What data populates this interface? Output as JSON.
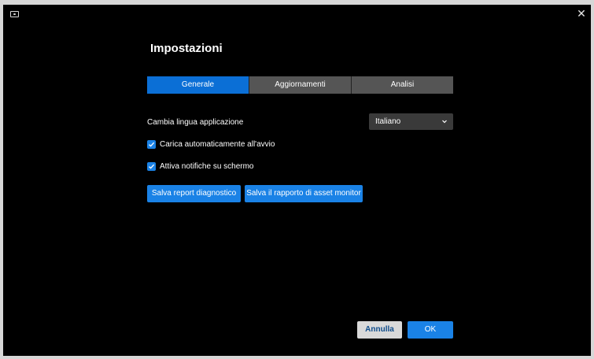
{
  "window": {
    "title": "Impostazioni"
  },
  "tabs": [
    {
      "label": "Generale",
      "active": true
    },
    {
      "label": "Aggiornamenti",
      "active": false
    },
    {
      "label": "Analisi",
      "active": false
    }
  ],
  "language": {
    "label": "Cambia lingua applicazione",
    "selected": "Italiano"
  },
  "options": [
    {
      "label": "Carica automaticamente all'avvio",
      "checked": true
    },
    {
      "label": "Attiva notifiche su schermo",
      "checked": true
    }
  ],
  "actions": {
    "diagnostic_label": "Salva report diagnostico",
    "asset_report_label": "Salva il rapporto di asset monitor"
  },
  "footer": {
    "cancel_label": "Annulla",
    "ok_label": "OK"
  },
  "colors": {
    "accent": "#1a82e6",
    "background": "#000000",
    "tab_inactive": "#555555"
  }
}
